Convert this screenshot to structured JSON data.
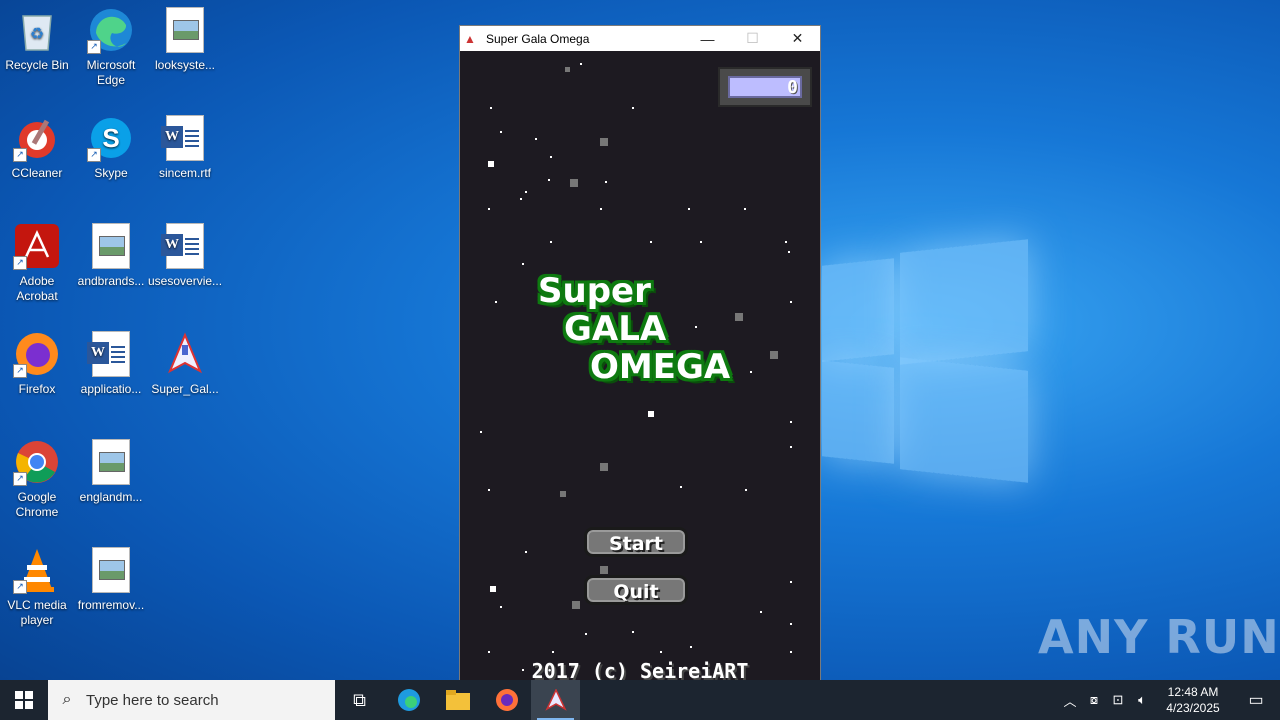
{
  "desktop": {
    "icons": [
      {
        "label": "Recycle Bin",
        "icon": "recycle-bin-icon"
      },
      {
        "label": "Microsoft Edge",
        "icon": "edge-icon"
      },
      {
        "label": "looksyste...",
        "icon": "image-file-icon"
      },
      {
        "label": "CCleaner",
        "icon": "ccleaner-icon"
      },
      {
        "label": "Skype",
        "icon": "skype-icon"
      },
      {
        "label": "sincem.rtf",
        "icon": "word-doc-icon"
      },
      {
        "label": "Adobe Acrobat",
        "icon": "acrobat-icon"
      },
      {
        "label": "andbrands...",
        "icon": "image-file-icon"
      },
      {
        "label": "usesovervie...",
        "icon": "word-doc-icon"
      },
      {
        "label": "Firefox",
        "icon": "firefox-icon"
      },
      {
        "label": "applicatio...",
        "icon": "word-doc-icon"
      },
      {
        "label": "Super_Gal...",
        "icon": "ship-icon"
      },
      {
        "label": "Google Chrome",
        "icon": "chrome-icon"
      },
      {
        "label": "englandm...",
        "icon": "image-file-icon"
      },
      {
        "label": "VLC media player",
        "icon": "vlc-icon"
      },
      {
        "label": "fromremov...",
        "icon": "image-file-icon"
      }
    ]
  },
  "window": {
    "title": "Super Gala Omega",
    "controls": {
      "minimize": "—",
      "maximize": "☐",
      "close": "✕"
    }
  },
  "game": {
    "score": "0",
    "logo": {
      "line1": "Super",
      "line2": "GALA",
      "line3": "OMEGA"
    },
    "start_label": "Start",
    "quit_label": "Quit",
    "credit": "2017 (c) SeireiART"
  },
  "watermark": "ANY RUN",
  "taskbar": {
    "search_placeholder": "Type here to search",
    "time": "12:48 AM",
    "date": "4/23/2025"
  },
  "colors": {
    "game_bg": "#1d1a21",
    "logo_outline": "#0e7a10",
    "score_fill": "#bdbdff",
    "taskbar_bg": "#1c2530"
  }
}
